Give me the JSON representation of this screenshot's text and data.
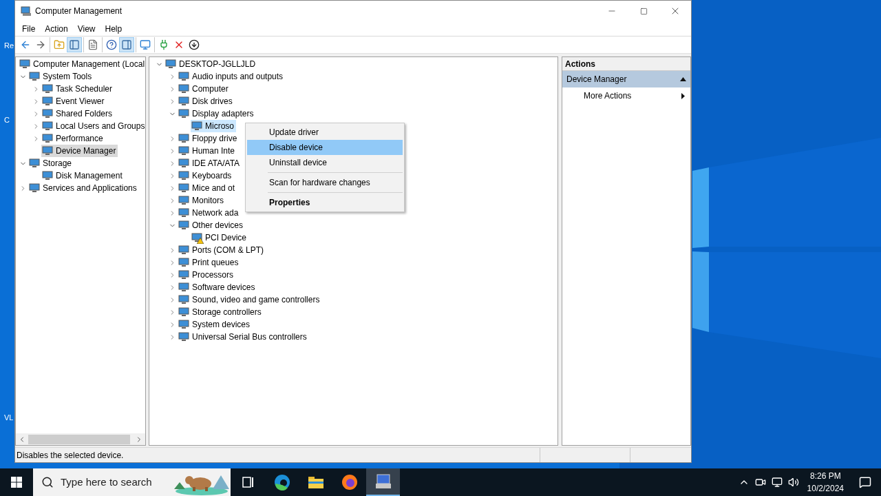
{
  "desktop": {
    "icons": [
      {
        "label": "Re"
      },
      {
        "label": "C"
      },
      {
        "label": "VL"
      }
    ]
  },
  "window": {
    "title": "Computer Management"
  },
  "menu_bar": [
    {
      "label": "File"
    },
    {
      "label": "Action"
    },
    {
      "label": "View"
    },
    {
      "label": "Help"
    }
  ],
  "toolbar": [
    [
      {
        "pressed": false
      },
      {
        "pressed": false
      }
    ],
    [
      {
        "pressed": false
      },
      {
        "pressed": true
      }
    ],
    [
      {
        "pressed": false
      }
    ],
    [
      {
        "pressed": false
      },
      {
        "pressed": true
      }
    ],
    [
      {
        "pressed": false
      }
    ],
    [
      {
        "pressed": false
      },
      {
        "pressed": false
      },
      {
        "pressed": false
      }
    ]
  ],
  "console_tree": [
    {
      "label": "Computer Management (Local",
      "selected": false,
      "children": [
        {
          "label": "System Tools",
          "expanded": true,
          "selected": false,
          "children": [
            {
              "label": "Task Scheduler",
              "expanded": false,
              "selected": false
            },
            {
              "label": "Event Viewer",
              "expanded": false,
              "selected": false
            },
            {
              "label": "Shared Folders",
              "expanded": false,
              "selected": false
            },
            {
              "label": "Local Users and Groups",
              "expanded": false,
              "selected": false
            },
            {
              "label": "Performance",
              "expanded": false,
              "selected": false
            },
            {
              "label": "Device Manager",
              "selected": true
            }
          ]
        },
        {
          "label": "Storage",
          "expanded": true,
          "selected": false,
          "children": [
            {
              "label": "Disk Management",
              "selected": false
            }
          ]
        },
        {
          "label": "Services and Applications",
          "expanded": false,
          "selected": false
        }
      ]
    }
  ],
  "device_tree": [
    {
      "label": "DESKTOP-JGLLJLD",
      "expanded": true,
      "selected": false,
      "children": [
        {
          "label": "Audio inputs and outputs",
          "expanded": false,
          "selected": false
        },
        {
          "label": "Computer",
          "expanded": false,
          "selected": false
        },
        {
          "label": "Disk drives",
          "expanded": false,
          "selected": false
        },
        {
          "label": "Display adapters",
          "expanded": true,
          "selected": false,
          "children": [
            {
              "label": "Microso",
              "selected": true,
              "warning": false
            }
          ]
        },
        {
          "label": "Floppy drive",
          "expanded": false,
          "selected": false
        },
        {
          "label": "Human Inte",
          "expanded": false,
          "selected": false
        },
        {
          "label": "IDE ATA/ATA",
          "expanded": false,
          "selected": false
        },
        {
          "label": "Keyboards",
          "expanded": false,
          "selected": false
        },
        {
          "label": "Mice and ot",
          "expanded": false,
          "selected": false
        },
        {
          "label": "Monitors",
          "expanded": false,
          "selected": false
        },
        {
          "label": "Network ada",
          "expanded": false,
          "selected": false
        },
        {
          "label": "Other devices",
          "expanded": true,
          "selected": false,
          "children": [
            {
              "label": "PCI Device",
              "selected": false,
              "warning": true
            }
          ]
        },
        {
          "label": "Ports (COM & LPT)",
          "expanded": false,
          "selected": false
        },
        {
          "label": "Print queues",
          "expanded": false,
          "selected": false
        },
        {
          "label": "Processors",
          "expanded": false,
          "selected": false
        },
        {
          "label": "Software devices",
          "expanded": false,
          "selected": false
        },
        {
          "label": "Sound, video and game controllers",
          "expanded": false,
          "selected": false
        },
        {
          "label": "Storage controllers",
          "expanded": false,
          "selected": false
        },
        {
          "label": "System devices",
          "expanded": false,
          "selected": false
        },
        {
          "label": "Universal Serial Bus controllers",
          "expanded": false,
          "selected": false
        }
      ]
    }
  ],
  "context_menu": [
    {
      "kind": "item",
      "label": "Update driver",
      "selected": false,
      "default": false
    },
    {
      "kind": "item",
      "label": "Disable device",
      "selected": true,
      "default": false
    },
    {
      "kind": "item",
      "label": "Uninstall device",
      "selected": false,
      "default": false
    },
    {
      "kind": "separator"
    },
    {
      "kind": "item",
      "label": "Scan for hardware changes",
      "selected": false,
      "default": false
    },
    {
      "kind": "separator"
    },
    {
      "kind": "item",
      "label": "Properties",
      "selected": false,
      "default": true
    }
  ],
  "actions_pane": {
    "title": "Actions",
    "items": [
      {
        "kind": "header",
        "label": "Device Manager"
      },
      {
        "kind": "submenu",
        "label": "More Actions"
      }
    ]
  },
  "status_bar": {
    "text": "Disables the selected device."
  },
  "taskbar": {
    "search": {
      "placeholder": "Type here to search"
    },
    "apps": [
      {
        "selected": false
      },
      {
        "selected": false
      },
      {
        "selected": false
      },
      {
        "selected": false
      },
      {
        "selected": true
      }
    ],
    "time": "8:26 PM",
    "date": "10/2/2024"
  }
}
